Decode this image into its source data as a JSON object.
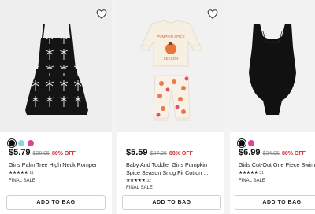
{
  "products": [
    {
      "swatches": [
        "#111111",
        "#8fd3e8",
        "#e0449a"
      ],
      "price": "$5.79",
      "was": "$28.95",
      "discount": "80% OFF",
      "title_line1": "Girls Palm Tree High Neck Romper",
      "title_line2": "",
      "stars": "★★★★★",
      "review_count": "11",
      "final_sale": "FINAL SALE",
      "button": "ADD TO BAG"
    },
    {
      "swatches": [],
      "price": "$5.59",
      "was": "$27.95",
      "discount": "80% OFF",
      "title_line1": "Baby And Toddler Girls Pumpkin",
      "title_line2": "Spice Season Snug Fit Cotton ...",
      "stars": "★★★★★",
      "review_count": "32",
      "final_sale": "FINAL SALE",
      "button": "ADD TO BAG"
    },
    {
      "swatches": [
        "#111111",
        "#e0449a"
      ],
      "price": "$6.99",
      "was": "$34.95",
      "discount": "80% OFF",
      "title_line1": "Girls Cut-Out One Piece Swimsuit",
      "title_line2": "",
      "stars": "★★★★★",
      "review_count": "31",
      "final_sale": "FINAL SALE",
      "button": "ADD TO BAG"
    }
  ],
  "icons": {
    "favorite": "heart-outline-icon"
  },
  "colors": {
    "discount": "#d7262e",
    "text": "#1a1a1a"
  }
}
